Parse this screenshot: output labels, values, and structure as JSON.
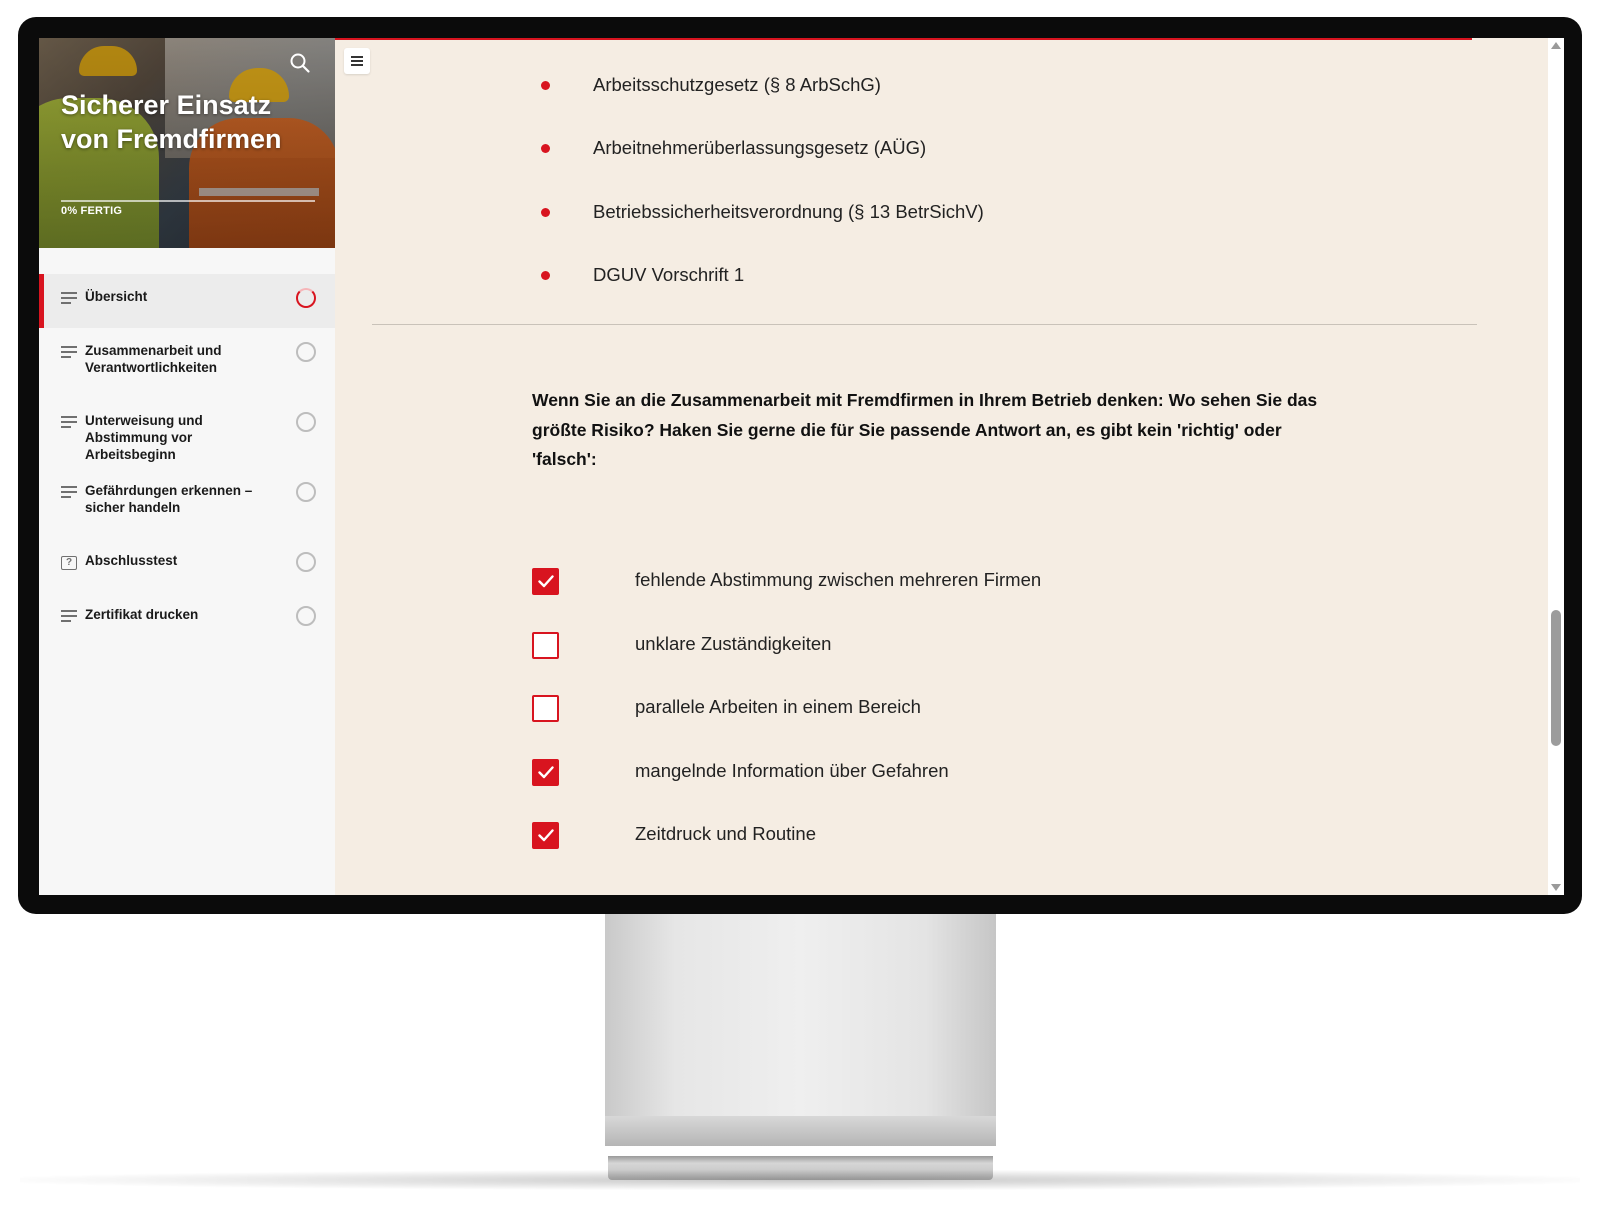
{
  "course": {
    "title": "Sicherer Einsatz von Fremdfirmen",
    "progress_label": "0% FERTIG"
  },
  "sidebar": {
    "items": [
      {
        "label": "Übersicht",
        "icon": "lines-icon",
        "active": true
      },
      {
        "label": "Zusammenarbeit und Verantwortlichkeiten",
        "icon": "lines-icon",
        "active": false
      },
      {
        "label": "Unterweisung und Abstimmung vor Arbeitsbeginn",
        "icon": "lines-icon",
        "active": false
      },
      {
        "label": "Gefährdungen erkennen – sicher handeln",
        "icon": "lines-icon",
        "active": false
      },
      {
        "label": "Abschlusstest",
        "icon": "question-box-icon",
        "active": false
      },
      {
        "label": "Zertifikat drucken",
        "icon": "lines-icon",
        "active": false
      }
    ]
  },
  "main": {
    "bullets": [
      "Arbeitsschutzgesetz (§ 8 ArbSchG)",
      "Arbeitnehmerüberlassungsgesetz (AÜG)",
      "Betriebssicherheitsverordnung (§ 13 BetrSichV)",
      "DGUV Vorschrift 1"
    ],
    "question": "Wenn Sie an die Zusammenarbeit mit Fremdfirmen in Ihrem Betrieb denken: Wo sehen Sie das größte Risiko? Haken Sie gerne die für Sie passende Antwort an, es gibt kein 'richtig' oder 'falsch':",
    "options": [
      {
        "label": "fehlende Abstimmung zwischen mehreren Firmen",
        "checked": true
      },
      {
        "label": "unklare Zuständigkeiten",
        "checked": false
      },
      {
        "label": "parallele Arbeiten in einem Bereich",
        "checked": false
      },
      {
        "label": "mangelnde Information über Gefahren",
        "checked": true
      },
      {
        "label": "Zeitdruck und Routine",
        "checked": true
      }
    ]
  },
  "colors": {
    "accent": "#d8141f",
    "content_background": "#f5ede3",
    "sidebar_background": "#f7f7f7"
  },
  "icons": {
    "search": "search-icon",
    "menu": "menu-icon",
    "check": "check-icon"
  }
}
